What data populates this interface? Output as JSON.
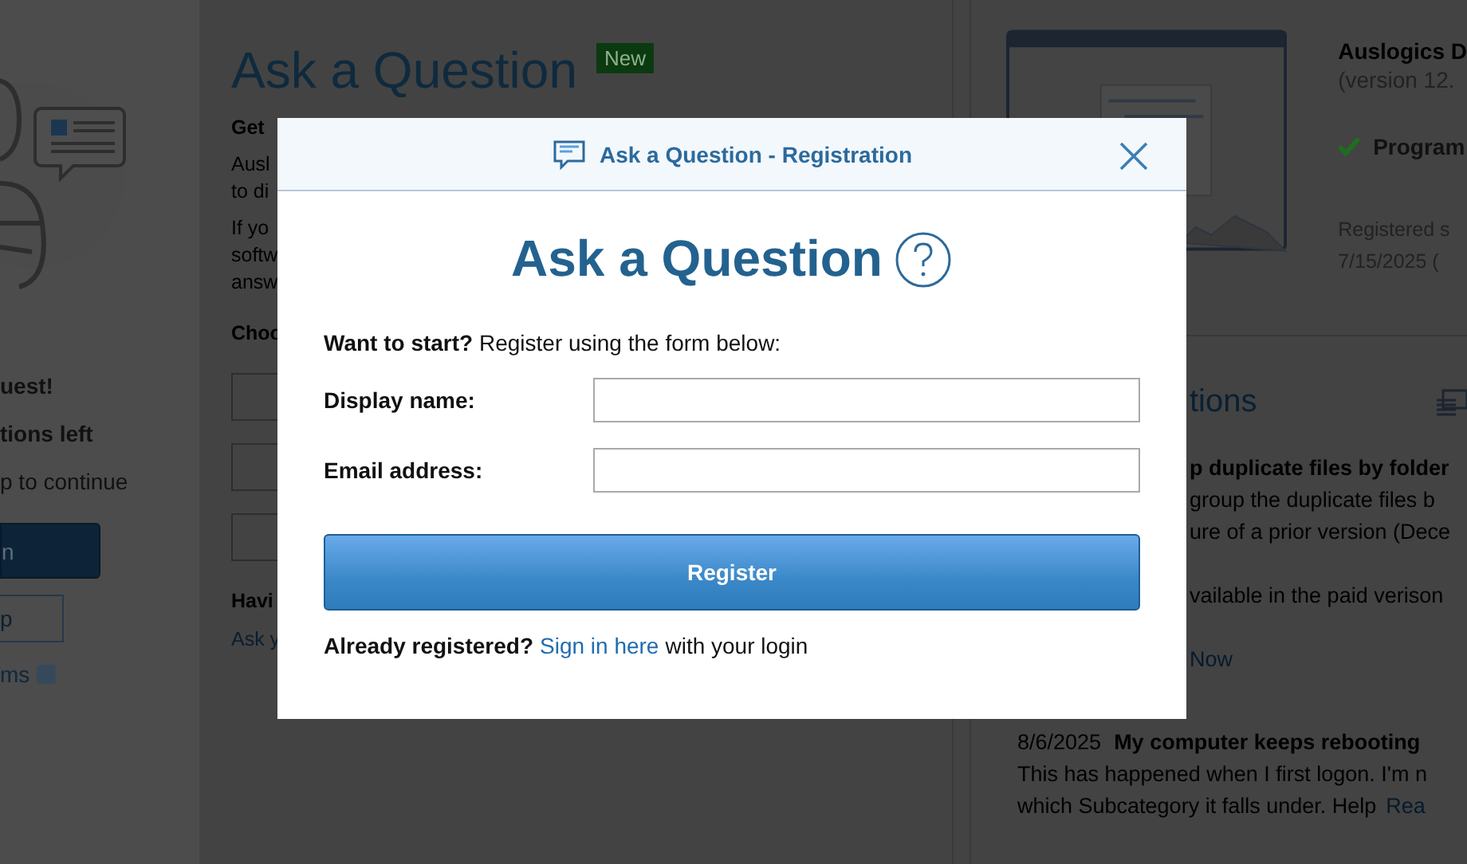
{
  "background": {
    "sidebar": {
      "lines": [
        {
          "text": "uest!",
          "kind": "bold"
        },
        {
          "text": "tions left",
          "kind": "bold"
        },
        {
          "text": "p to continue",
          "kind": "plain"
        }
      ],
      "primary_button": "n",
      "secondary_button": "p",
      "link": "ms"
    },
    "main": {
      "title": "Ask a Question",
      "badge": "New",
      "heading": "Get",
      "paragraphs": [
        [
          "Ausl",
          "to di"
        ],
        [
          "If yo",
          "softw",
          "answ"
        ]
      ],
      "choose_label": "Choo",
      "having_label": "Havi",
      "ask_link": "Ask y"
    },
    "product": {
      "name": "Auslogics D",
      "version": "(version 12.",
      "status": "Program",
      "registered": [
        "Registered s",
        "7/15/2025 ("
      ]
    },
    "questions": {
      "title": "tions",
      "items": [
        {
          "title": "p duplicate files by folder",
          "paragraphs": [
            [
              "group the duplicate files b",
              "ure of a prior version (Dece"
            ],
            [
              "vailable in the paid verison"
            ]
          ],
          "link": "Now"
        },
        {
          "date": "8/6/2025",
          "title": "My computer keeps rebooting",
          "paragraphs": [
            [
              "This has happened when I first logon. I'm n",
              "which Subcategory it falls under. Help"
            ]
          ],
          "link": "Rea"
        }
      ]
    }
  },
  "dialog": {
    "title": "Ask a Question - Registration",
    "heading": "Ask a Question",
    "intro": "**Want to start?** Register using the form below:",
    "fields": [
      {
        "label": "Display name:"
      },
      {
        "label": "Email address:"
      }
    ],
    "submit": "Register",
    "footer": {
      "prefix": "Already registered?",
      "link": "Sign in here",
      "suffix": "with your login"
    }
  }
}
